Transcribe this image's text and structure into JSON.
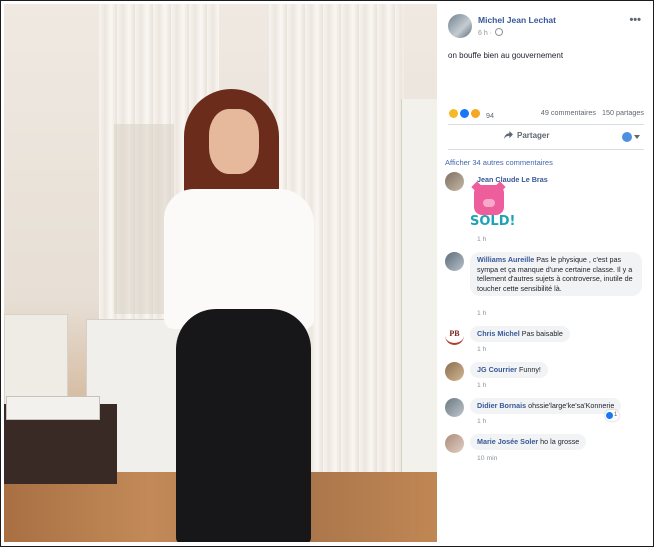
{
  "post": {
    "author": "Michel Jean Lechat",
    "time": "6 h",
    "privacy_icon": "globe-icon",
    "text": "on bouffe bien au gouvernement",
    "reaction_count": "94",
    "reaction_icons": [
      "haha",
      "like",
      "wow"
    ],
    "comment_count": "49 commentaires",
    "share_count": "150 partages",
    "share_label": "Partager"
  },
  "comments_section": {
    "more_comments": "Afficher 34 autres commentaires",
    "comments": [
      {
        "name": "Jean Claude Le Bras",
        "text": "",
        "sticker_text": "SOLD!",
        "time": "1 h"
      },
      {
        "name": "Williams Aureille",
        "text": "Pas le physique , c'est pas sympa et ça manque d'une certaine classe. Il y a tellement d'autres sujets à controverse, inutile de toucher cette sensibilité là.",
        "time": "1 h"
      },
      {
        "name": "Chris Michel",
        "text": "Pas baisable",
        "time": "1 h",
        "avatar_text": "PB"
      },
      {
        "name": "JG Courrier",
        "text": "Funny!",
        "time": "1 h"
      },
      {
        "name": "Didier Bornais",
        "text": "ohssie'large'ke'sa'Konnerie",
        "time": "1 h",
        "likes": "1"
      },
      {
        "name": "Marie Josée Soler",
        "text": "ho la grosse",
        "time": "10 min"
      }
    ]
  },
  "colors": {
    "link_blue": "#365899",
    "bubble_bg": "#f2f3f5",
    "meta_gray": "#90949c"
  }
}
